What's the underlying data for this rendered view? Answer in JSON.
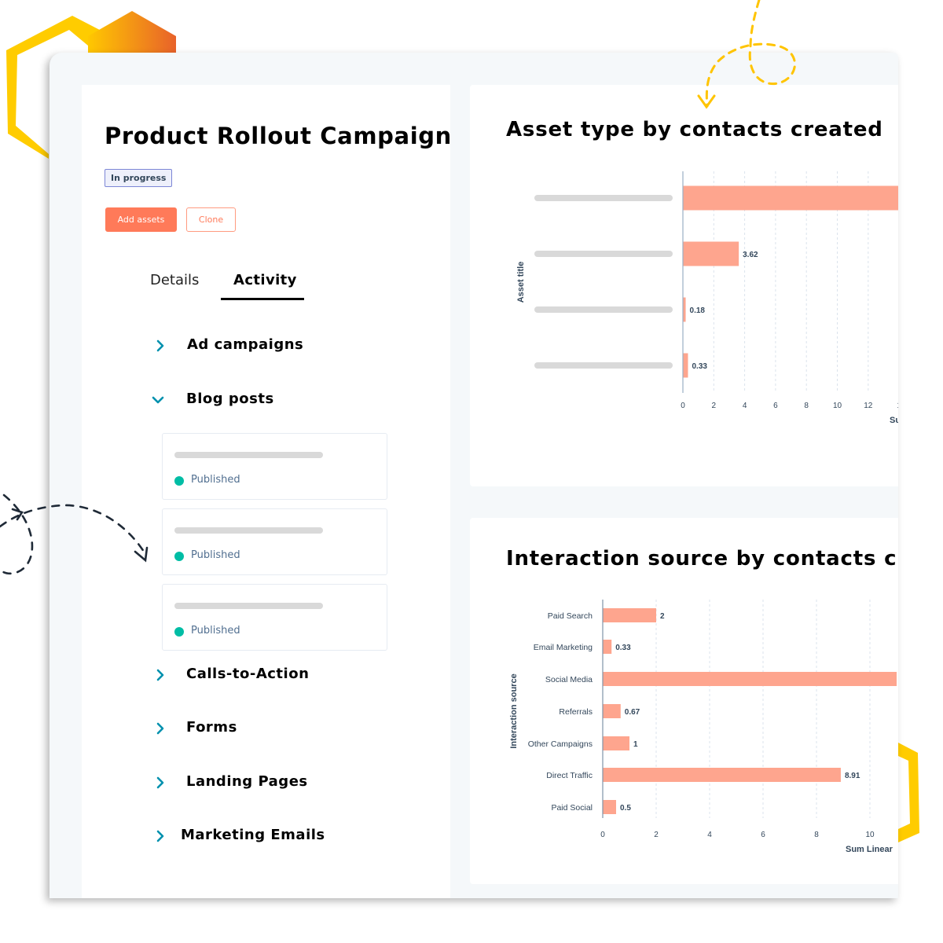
{
  "campaign": {
    "title": "Product Rollout Campaign",
    "status_badge": "In progress",
    "buttons": {
      "add_assets": "Add assets",
      "clone": "Clone"
    },
    "tabs": [
      {
        "label": "Details",
        "active": false
      },
      {
        "label": "Activity",
        "active": true
      }
    ],
    "sections": [
      {
        "label": "Ad campaigns",
        "expanded": false,
        "icon": "chevron-right-icon"
      },
      {
        "label": "Blog posts",
        "expanded": true,
        "icon": "chevron-down-icon",
        "items": [
          {
            "status": "Published",
            "status_color": "#00bda5"
          },
          {
            "status": "Published",
            "status_color": "#00bda5"
          },
          {
            "status": "Published",
            "status_color": "#00bda5"
          }
        ]
      },
      {
        "label": "Calls-to-Action",
        "expanded": false,
        "icon": "chevron-right-icon"
      },
      {
        "label": "Forms",
        "expanded": false,
        "icon": "chevron-right-icon"
      },
      {
        "label": "Landing Pages",
        "expanded": false,
        "icon": "chevron-right-icon"
      },
      {
        "label": "Marketing Emails",
        "expanded": false,
        "icon": "chevron-right-icon"
      }
    ]
  },
  "colors": {
    "accent": "#ff7a59",
    "bar": "#fea58e",
    "chevron": "#0091ae",
    "published": "#00bda5",
    "text_secondary": "#33475b"
  },
  "chart_data": [
    {
      "type": "bar",
      "orientation": "horizontal",
      "title": "Asset type by contacts created",
      "ylabel": "Asset title",
      "xlabel": "Su",
      "categories": [
        "",
        "",
        "",
        ""
      ],
      "category_labels_redacted": true,
      "values": [
        14,
        3.62,
        0.18,
        0.33
      ],
      "data_labels": [
        "",
        "3.62",
        "0.18",
        "0.33"
      ],
      "x_ticks": [
        "0",
        "2",
        "4",
        "6",
        "8",
        "10",
        "12",
        "1"
      ],
      "xlim": [
        0,
        14
      ],
      "grid": true
    },
    {
      "type": "bar",
      "orientation": "horizontal",
      "title": "Interaction source by contacts cr",
      "ylabel": "Interaction source",
      "xlabel": "Sum Linear",
      "categories": [
        "Paid Search",
        "Email Marketing",
        "Social Media",
        "Referrals",
        "Other Campaigns",
        "Direct Traffic",
        "Paid Social"
      ],
      "values": [
        2,
        0.33,
        11,
        0.67,
        1,
        8.91,
        0.5
      ],
      "data_labels": [
        "2",
        "0.33",
        "",
        "0.67",
        "1",
        "8.91",
        "0.5"
      ],
      "x_ticks": [
        "0",
        "2",
        "4",
        "6",
        "8",
        "10"
      ],
      "xlim": [
        0,
        11
      ],
      "grid": true
    }
  ]
}
